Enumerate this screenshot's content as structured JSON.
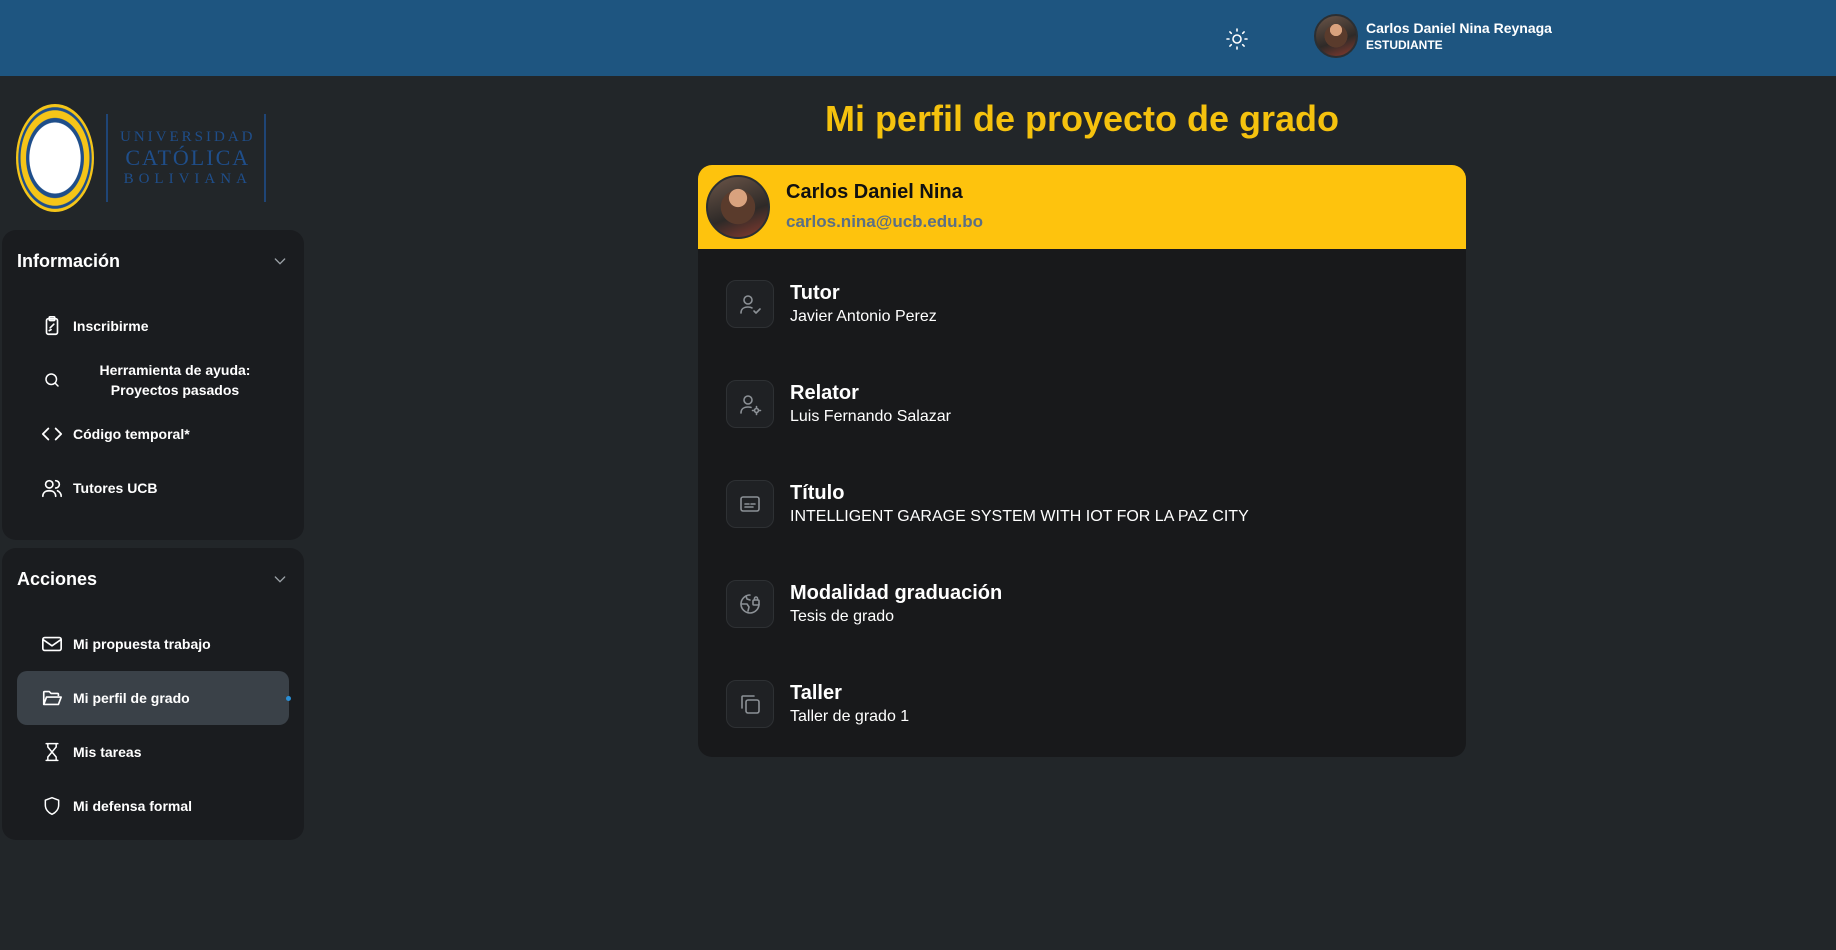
{
  "header": {
    "user_name": "Carlos Daniel Nina Reynaga",
    "user_role": "ESTUDIANTE",
    "theme_icon": "sun-icon"
  },
  "logo": {
    "line1": "UNIVERSIDAD",
    "line2": "CATÓLICA",
    "line3": "BOLIVIANA"
  },
  "sidebar": {
    "info_title": "Información",
    "info_items": [
      {
        "label": "Inscribirme",
        "icon": "clipboard-icon"
      },
      {
        "label": "Herramienta de ayuda: Proyectos pasados",
        "icon": "search-icon"
      },
      {
        "label": "Código temporal*",
        "icon": "code-icon"
      },
      {
        "label": "Tutores UCB",
        "icon": "users-icon"
      }
    ],
    "actions_title": "Acciones",
    "action_items": [
      {
        "label": "Mi propuesta trabajo",
        "icon": "mail-icon"
      },
      {
        "label": "Mi perfil de grado",
        "icon": "folder-open-icon",
        "active": true
      },
      {
        "label": "Mis tareas",
        "icon": "hourglass-icon"
      },
      {
        "label": "Mi defensa formal",
        "icon": "shield-icon"
      }
    ]
  },
  "main": {
    "title": "Mi perfil de proyecto de grado",
    "profile": {
      "name": "Carlos Daniel Nina",
      "email": "carlos.nina@ucb.edu.bo"
    },
    "fields": [
      {
        "label": "Tutor",
        "value": "Javier Antonio Perez",
        "icon": "user-check-icon"
      },
      {
        "label": "Relator",
        "value": "Luis Fernando Salazar",
        "icon": "user-cog-icon"
      },
      {
        "label": "Título",
        "value": "INTELLIGENT GARAGE SYSTEM WITH IOT FOR LA PAZ CITY",
        "icon": "subtitles-icon"
      },
      {
        "label": "Modalidad graduación",
        "value": "Tesis de grado",
        "icon": "globe-lock-icon"
      },
      {
        "label": "Taller",
        "value": "Taller de grado 1",
        "icon": "copy-icon"
      }
    ]
  },
  "colors": {
    "topbar": "#1e5580",
    "accent_yellow": "#fec30d",
    "title_yellow": "#f5c20e",
    "background": "#222629",
    "panel": "#1a1c1f"
  }
}
